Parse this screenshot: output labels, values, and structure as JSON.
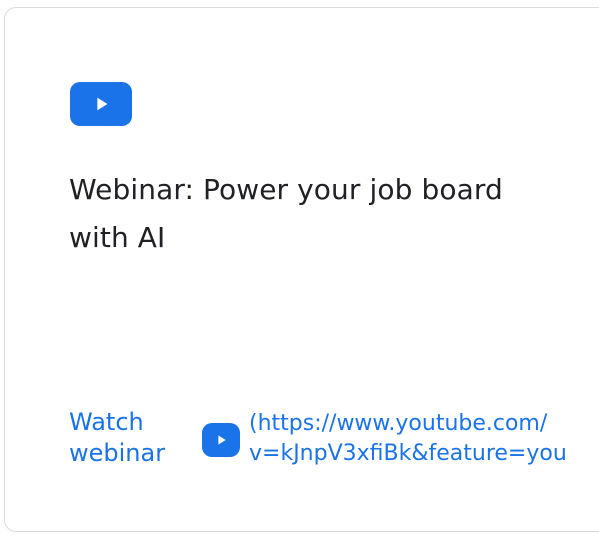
{
  "card": {
    "title": "Webinar: Power your job board with AI",
    "footer": {
      "watch_label": "Watch webinar",
      "url_line_1": "(https://www.youtube.com/",
      "url_line_2": "v=kJnpV3xfiBk&feature=you"
    }
  },
  "icons": {
    "top": "youtube-play-icon",
    "inline": "youtube-play-icon"
  },
  "colors": {
    "accent": "#1a73e8",
    "text": "#202124",
    "border": "#dadce0",
    "background": "#ffffff"
  }
}
